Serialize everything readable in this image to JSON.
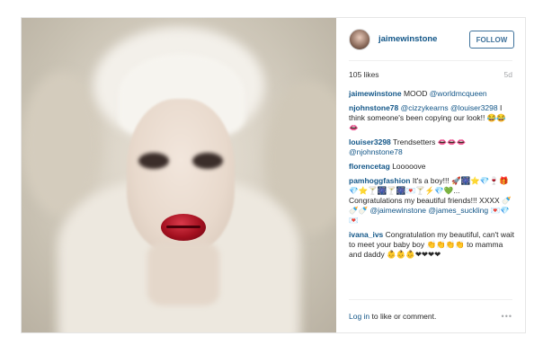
{
  "post": {
    "username": "jaimewinstone",
    "follow_label": "FOLLOW",
    "likes": "105 likes",
    "age": "5d",
    "comments": [
      {
        "user": "jaimewinstone",
        "text": " MOOD ",
        "mention": "@worldmcqueen",
        "tail": ""
      },
      {
        "user": "njohnstone78",
        "text": " ",
        "mention": "@cizzykearns @louiser3298",
        "tail": " I think someone's been copying our look!! 😂😂👄"
      },
      {
        "user": "louiser3298",
        "text": " Trendsetters 👄👄👄",
        "mention": "@njohnstone78",
        "tail": ""
      },
      {
        "user": "florencetag",
        "text": " Looooove",
        "mention": "",
        "tail": ""
      },
      {
        "user": "pamhoggfashion",
        "text": " It's a boy!!! 🚀🎆⭐💎🍷🎁💎⭐🍸🎆🍸🎆💌🍸⚡💎💚... Congratulations my beautiful friends!!! XXXX 🍼🍼🍼 ",
        "mention": "@jaimewinstone @james_suckling",
        "tail": " 💌💎💌"
      },
      {
        "user": "ivana_ivs",
        "text": " Congratulation my beautiful, can't wait to meet your baby boy 👏👏👏👏 to mamma and daddy 👶👶👶❤❤❤❤",
        "mention": "",
        "tail": ""
      }
    ],
    "login_link": "Log in",
    "login_text": " to like or comment.",
    "more_label": "•••"
  },
  "icons": {
    "avatar": "user-avatar",
    "more": "more-options-icon"
  },
  "colors": {
    "link": "#125688",
    "follow_border": "#3f729b",
    "muted": "#a5a7aa"
  }
}
